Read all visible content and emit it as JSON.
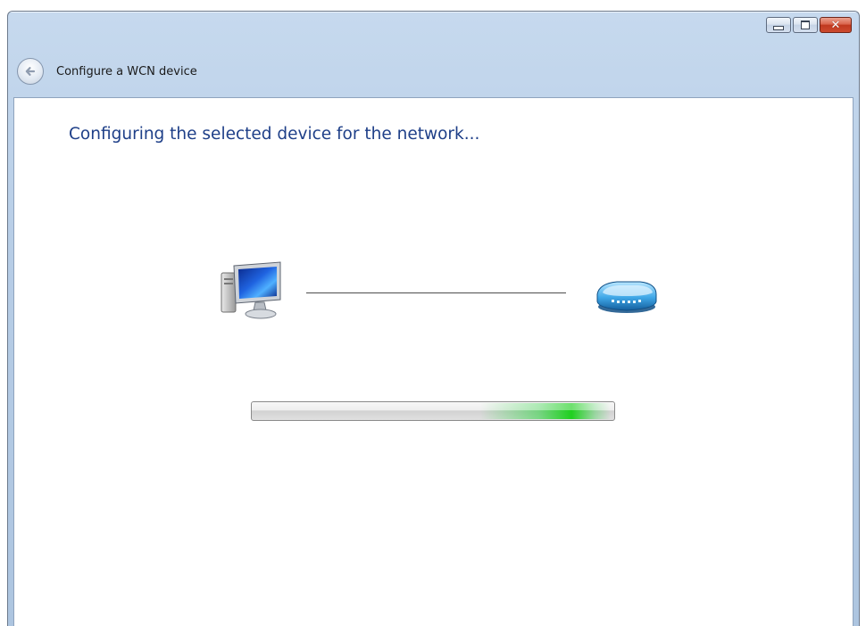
{
  "window": {
    "title": "Configure a WCN device",
    "caption_buttons": [
      "minimize",
      "maximize",
      "close"
    ]
  },
  "main": {
    "heading": "Configuring the selected device for the network..."
  },
  "devices": {
    "left_icon": "computer-icon",
    "right_icon": "router-icon"
  },
  "progress": {
    "style": "marquee",
    "glow_start_fraction": 0.63,
    "glow_end_fraction": 0.99
  },
  "colors": {
    "heading": "#1e3f88",
    "titlebar": "#b7cde6",
    "progress_green": "#20d020"
  }
}
